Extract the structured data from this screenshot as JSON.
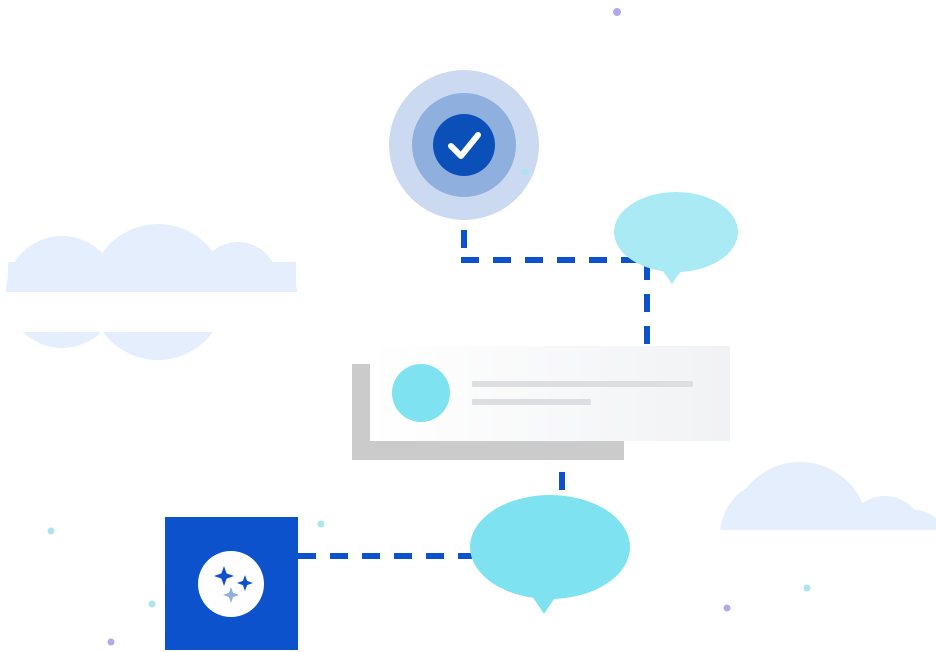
{
  "colors": {
    "background": "#ffffff",
    "cloud": "#e4eefc",
    "connector": "#0b52cc",
    "check_outer_ring": "#cbdaf0",
    "check_mid_ring": "#8fb0de",
    "check_core": "#0b4fb8",
    "check_mark": "#ffffff",
    "bubble_light": "#a9eaf4",
    "bubble_bright": "#7ee2f0",
    "card_back": "#cbcbcb",
    "card_front": "#f5f6f8",
    "card_avatar": "#7ee2f0",
    "card_line": "#dcdee2",
    "ai_tile": "#0b52cc",
    "ai_tile_circle": "#ffffff",
    "sparkle_dark": "#0b52cc",
    "sparkle_light": "#8fb0de",
    "dot_purple": "#b3a9ea",
    "dot_cyan": "#aee3f0"
  },
  "icons": {
    "check": "check-icon",
    "sparkles": "sparkles-icon"
  }
}
